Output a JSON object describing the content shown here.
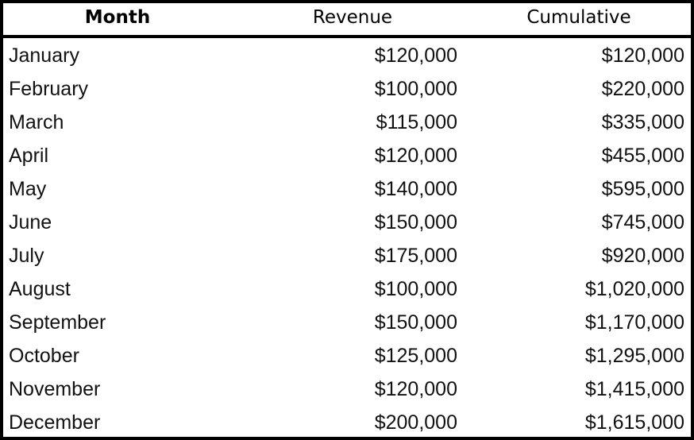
{
  "table": {
    "headers": {
      "month": "Month",
      "revenue": "Revenue",
      "cumulative": "Cumulative"
    },
    "rows": [
      {
        "month": "January",
        "revenue": "$120,000",
        "cumulative": "$120,000"
      },
      {
        "month": "February",
        "revenue": "$100,000",
        "cumulative": "$220,000"
      },
      {
        "month": "March",
        "revenue": "$115,000",
        "cumulative": "$335,000"
      },
      {
        "month": "April",
        "revenue": "$120,000",
        "cumulative": "$455,000"
      },
      {
        "month": "May",
        "revenue": "$140,000",
        "cumulative": "$595,000"
      },
      {
        "month": "June",
        "revenue": "$150,000",
        "cumulative": "$745,000"
      },
      {
        "month": "July",
        "revenue": "$175,000",
        "cumulative": "$920,000"
      },
      {
        "month": "August",
        "revenue": "$100,000",
        "cumulative": "$1,020,000"
      },
      {
        "month": "September",
        "revenue": "$150,000",
        "cumulative": "$1,170,000"
      },
      {
        "month": "October",
        "revenue": "$125,000",
        "cumulative": "$1,295,000"
      },
      {
        "month": "November",
        "revenue": "$120,000",
        "cumulative": "$1,415,000"
      },
      {
        "month": "December",
        "revenue": "$200,000",
        "cumulative": "$1,615,000"
      }
    ]
  }
}
